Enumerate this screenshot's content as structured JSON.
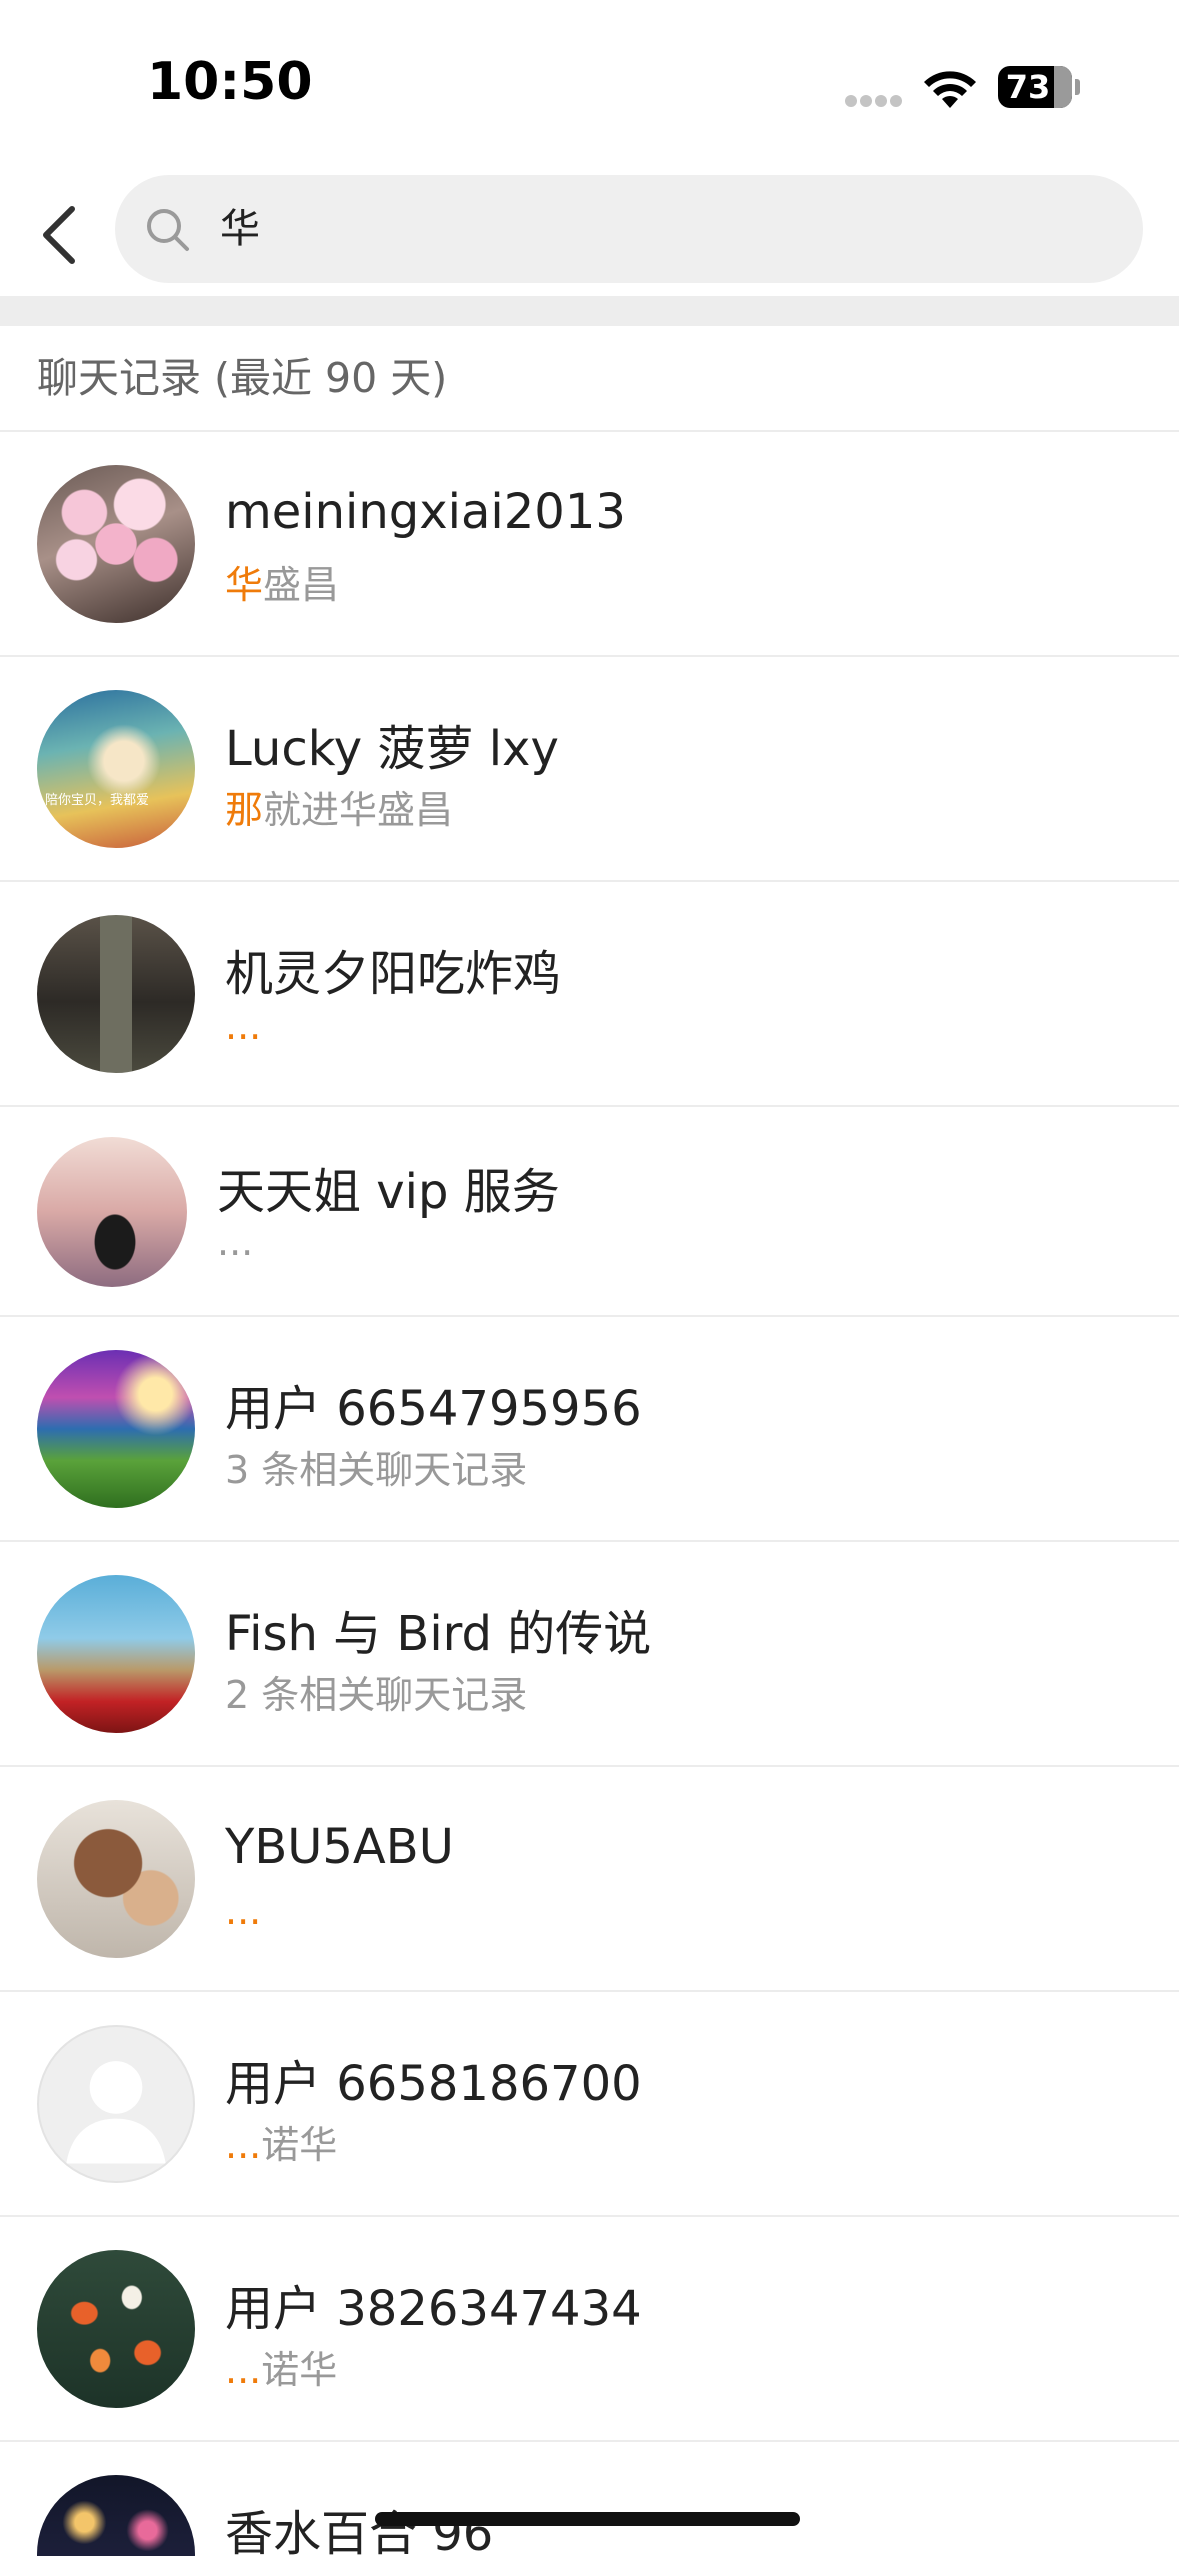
{
  "status_bar": {
    "time": "10:50",
    "battery": "73"
  },
  "search": {
    "query": "华"
  },
  "section": {
    "title": "聊天记录 (最近 90 天)"
  },
  "results": [
    {
      "name": "meiningxiai2013",
      "snippet_highlight": "华",
      "snippet_rest": "盛昌",
      "avatar": "cherry-blossom-photo"
    },
    {
      "name": "Lucky 菠萝 lxy",
      "snippet_highlight": "那",
      "snippet_rest": "就进华盛昌",
      "avatar": "girl-portrait-photo",
      "avatar_caption": "陪你宝贝，我都爱"
    },
    {
      "name": "机灵夕阳吃炸鸡",
      "snippet_highlight": "...",
      "snippet_rest": "",
      "avatar": "alley-photo"
    },
    {
      "name": "天天姐 vip 服务",
      "snippet_highlight": "",
      "snippet_rest": "...",
      "avatar": "woman-back-photo"
    },
    {
      "name": "用户 6654795956",
      "snippet_highlight": "",
      "snippet_rest": "3 条相关聊天记录",
      "avatar": "rice-terrace-photo"
    },
    {
      "name": "Fish 与 Bird 的传说",
      "snippet_highlight": "",
      "snippet_rest": "2 条相关聊天记录",
      "avatar": "red-carpet-photo"
    },
    {
      "name": "YBU5ABU",
      "snippet_highlight": "...",
      "snippet_rest": "",
      "avatar": "teddy-bear-photo"
    },
    {
      "name": "用户 6658186700",
      "snippet_highlight": "...",
      "snippet_rest": "诺华",
      "avatar": "default-user-icon"
    },
    {
      "name": "用户 3826347434",
      "snippet_highlight": "...",
      "snippet_rest": "诺华",
      "avatar": "koi-fish-photo"
    },
    {
      "name": "香水百合 96",
      "snippet_highlight": "",
      "snippet_rest": "",
      "avatar": "fireworks-photo"
    }
  ],
  "colors": {
    "highlight": "#ef7b0a",
    "snippet": "#999999",
    "search_bg": "#efefef"
  }
}
